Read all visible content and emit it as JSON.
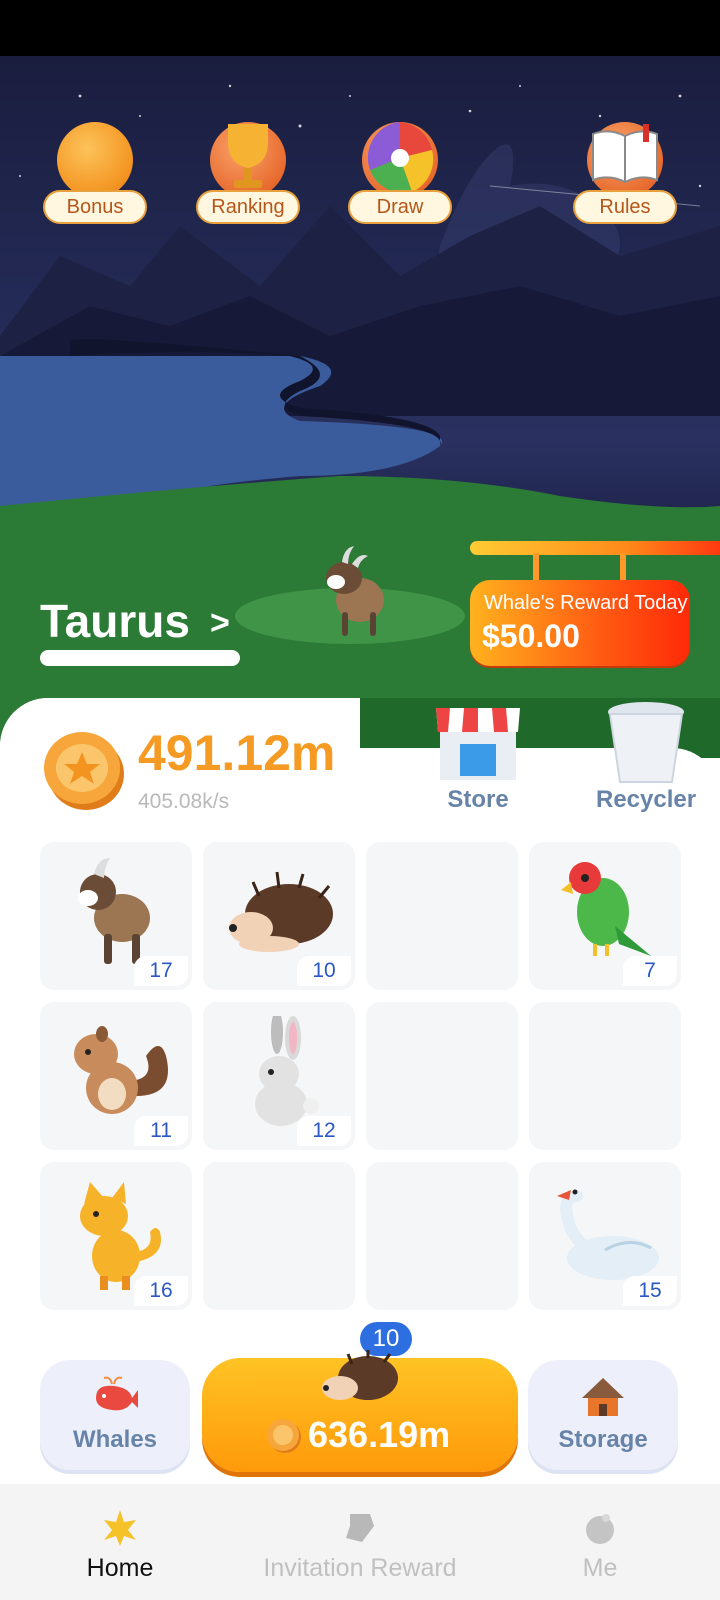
{
  "top_menu": {
    "bonus": "Bonus",
    "ranking": "Ranking",
    "draw": "Draw",
    "rules": "Rules"
  },
  "zodiac": {
    "name": "Taurus",
    "arrow": ">"
  },
  "reward": {
    "title": "Whale's Reward Today",
    "value": "$50.00"
  },
  "wallet": {
    "balance": "491.12m",
    "rate": "405.08k/s"
  },
  "tools": {
    "store": "Store",
    "recycler": "Recycler"
  },
  "grid": {
    "cells": [
      {
        "animal": "goat-icon",
        "level": "17"
      },
      {
        "animal": "hedgehog-icon",
        "level": "10"
      },
      {
        "animal": "",
        "level": ""
      },
      {
        "animal": "parrot-icon",
        "level": "7"
      },
      {
        "animal": "chipmunk-icon",
        "level": "11"
      },
      {
        "animal": "rabbit-icon",
        "level": "12"
      },
      {
        "animal": "",
        "level": ""
      },
      {
        "animal": "",
        "level": ""
      },
      {
        "animal": "cat-icon",
        "level": "16"
      },
      {
        "animal": "",
        "level": ""
      },
      {
        "animal": "",
        "level": ""
      },
      {
        "animal": "swan-icon",
        "level": "15"
      }
    ]
  },
  "actions": {
    "whales": "Whales",
    "storage": "Storage",
    "buy_level": "10",
    "buy_price": "636.19m"
  },
  "nav": {
    "home": "Home",
    "invitation": "Invitation Reward",
    "me": "Me"
  },
  "colors": {
    "accent_orange": "#f59a23",
    "label_blue": "#6784a8",
    "level_blue": "#2b56c4"
  }
}
